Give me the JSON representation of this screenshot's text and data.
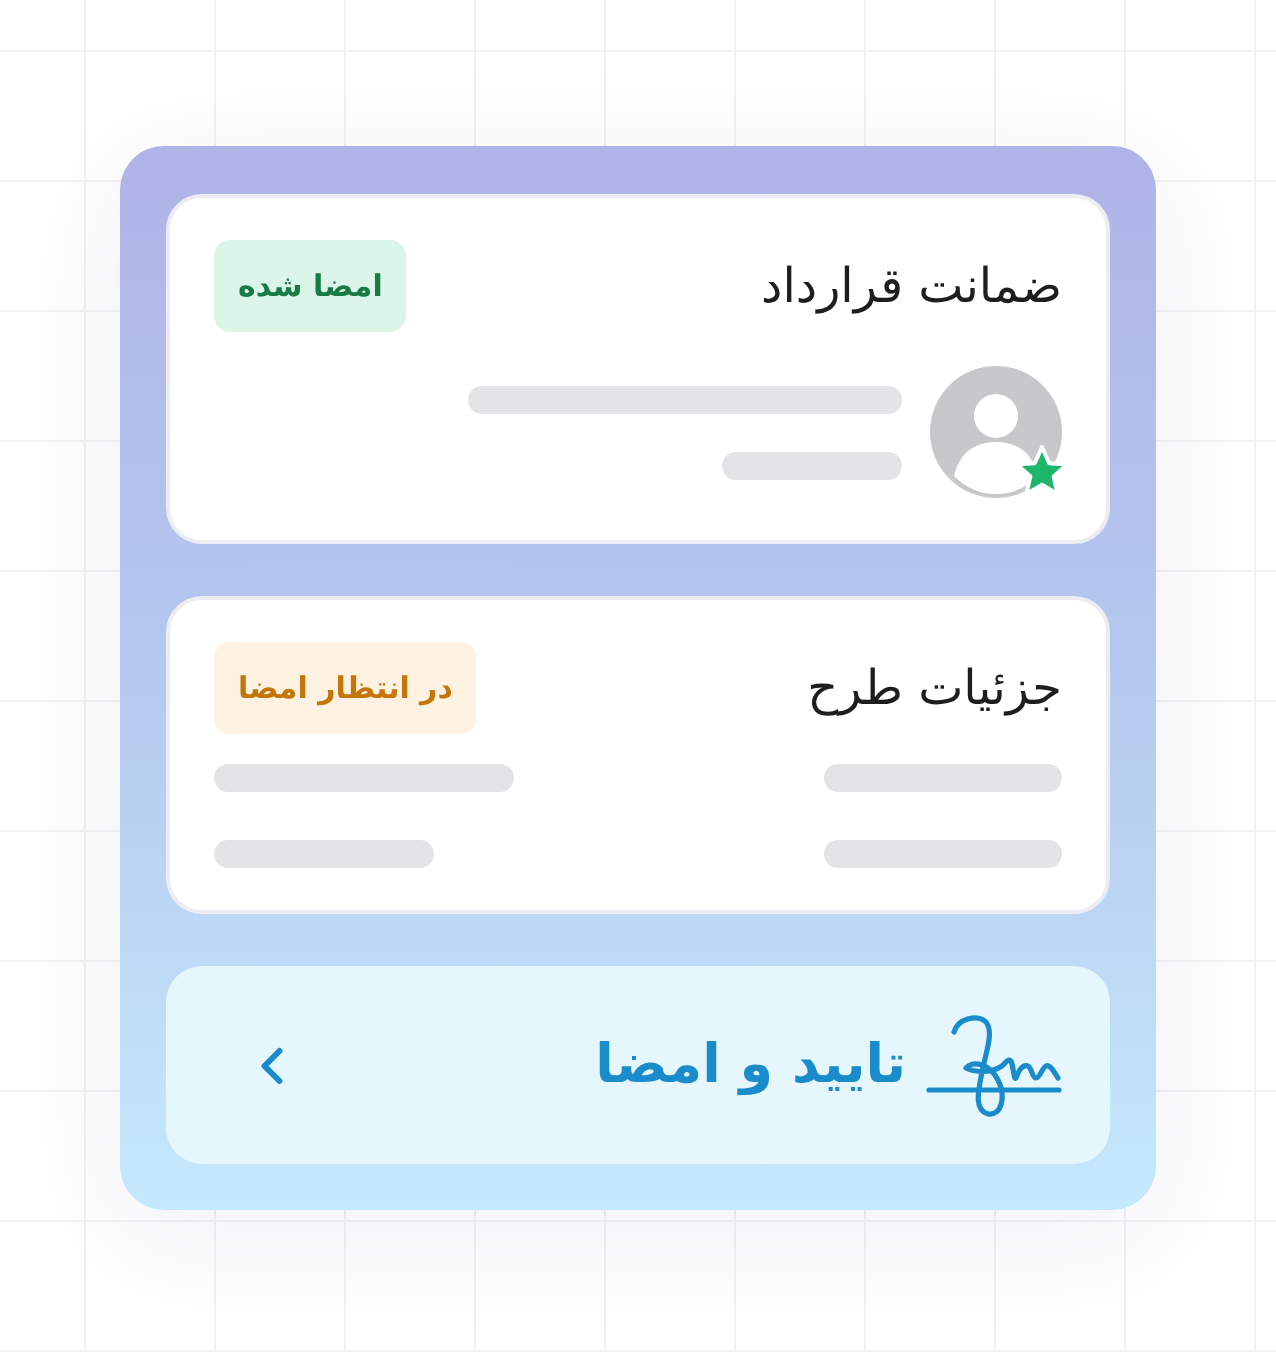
{
  "cards": [
    {
      "kind": "signer",
      "title": "ضمانت قرارداد",
      "status": {
        "kind": "signed",
        "label": "امضا شده"
      }
    },
    {
      "kind": "details",
      "title": "جزئیات طرح",
      "status": {
        "kind": "pending",
        "label": "در انتظار امضا"
      }
    }
  ],
  "action": {
    "label": "تایید و امضا"
  }
}
